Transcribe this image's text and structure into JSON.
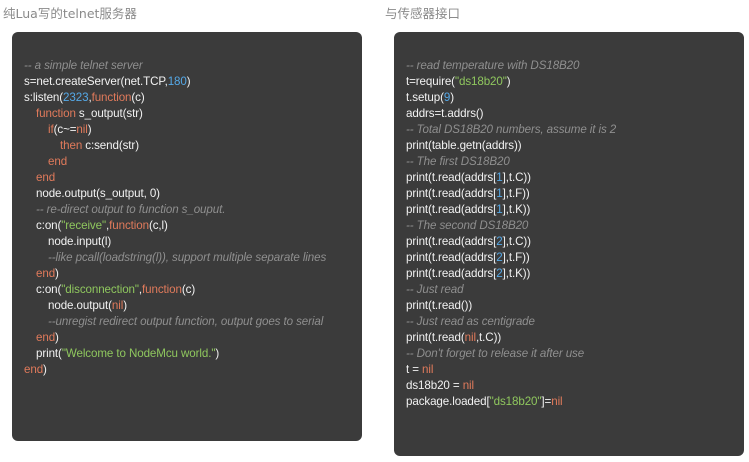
{
  "left": {
    "heading": "纯Lua写的telnet服务器",
    "lines": [
      {
        "indent": 0,
        "segs": [
          {
            "t": "cm",
            "v": "-- a simple telnet server"
          }
        ]
      },
      {
        "indent": 0,
        "segs": [
          {
            "t": "tx",
            "v": "s=net.createServer(net.TCP,"
          },
          {
            "t": "nu",
            "v": "180"
          },
          {
            "t": "tx",
            "v": ")"
          }
        ]
      },
      {
        "indent": 0,
        "segs": [
          {
            "t": "tx",
            "v": "s:listen("
          },
          {
            "t": "nu",
            "v": "2323"
          },
          {
            "t": "tx",
            "v": ","
          },
          {
            "t": "kw",
            "v": "function"
          },
          {
            "t": "tx",
            "v": "(c)"
          }
        ]
      },
      {
        "indent": 1,
        "segs": [
          {
            "t": "kw",
            "v": "function"
          },
          {
            "t": "tx",
            "v": " s_output(str)"
          }
        ]
      },
      {
        "indent": 2,
        "segs": [
          {
            "t": "kw",
            "v": "if"
          },
          {
            "t": "tx",
            "v": "(c~="
          },
          {
            "t": "kw",
            "v": "nil"
          },
          {
            "t": "tx",
            "v": ")"
          }
        ]
      },
      {
        "indent": 3,
        "segs": [
          {
            "t": "kw",
            "v": "then"
          },
          {
            "t": "tx",
            "v": " c:send(str)"
          }
        ]
      },
      {
        "indent": 2,
        "segs": [
          {
            "t": "kw",
            "v": "end"
          }
        ]
      },
      {
        "indent": 1,
        "segs": [
          {
            "t": "kw",
            "v": "end"
          }
        ]
      },
      {
        "indent": 1,
        "segs": [
          {
            "t": "tx",
            "v": "node.output(s_output, 0)"
          }
        ]
      },
      {
        "indent": 1,
        "segs": [
          {
            "t": "cm",
            "v": "-- re-direct output to function s_ouput."
          }
        ]
      },
      {
        "indent": 1,
        "segs": [
          {
            "t": "tx",
            "v": "c:on("
          },
          {
            "t": "st",
            "v": "\"receive\""
          },
          {
            "t": "tx",
            "v": ","
          },
          {
            "t": "kw",
            "v": "function"
          },
          {
            "t": "tx",
            "v": "(c,l)"
          }
        ]
      },
      {
        "indent": 2,
        "segs": [
          {
            "t": "tx",
            "v": "node.input(l)"
          }
        ]
      },
      {
        "indent": 2,
        "segs": [
          {
            "t": "cm",
            "v": "--like pcall(loadstring(l)), support multiple separate lines"
          }
        ]
      },
      {
        "indent": 1,
        "segs": [
          {
            "t": "kw",
            "v": "end"
          },
          {
            "t": "tx",
            "v": ")"
          }
        ]
      },
      {
        "indent": 1,
        "segs": [
          {
            "t": "tx",
            "v": "c:on("
          },
          {
            "t": "st",
            "v": "\"disconnection\""
          },
          {
            "t": "tx",
            "v": ","
          },
          {
            "t": "kw",
            "v": "function"
          },
          {
            "t": "tx",
            "v": "(c)"
          }
        ]
      },
      {
        "indent": 2,
        "segs": [
          {
            "t": "tx",
            "v": "node.output("
          },
          {
            "t": "kw",
            "v": "nil"
          },
          {
            "t": "tx",
            "v": ")"
          }
        ]
      },
      {
        "indent": 2,
        "segs": [
          {
            "t": "cm",
            "v": "--unregist redirect output function, output goes to serial"
          }
        ]
      },
      {
        "indent": 1,
        "segs": [
          {
            "t": "kw",
            "v": "end"
          },
          {
            "t": "tx",
            "v": ")"
          }
        ]
      },
      {
        "indent": 1,
        "segs": [
          {
            "t": "tx",
            "v": "print("
          },
          {
            "t": "st",
            "v": "\"Welcome to NodeMcu world.\""
          },
          {
            "t": "tx",
            "v": ")"
          }
        ]
      },
      {
        "indent": 0,
        "segs": [
          {
            "t": "kw",
            "v": "end"
          },
          {
            "t": "tx",
            "v": ")"
          }
        ]
      }
    ]
  },
  "right": {
    "heading": "与传感器接口",
    "lines": [
      {
        "indent": 0,
        "segs": [
          {
            "t": "cm",
            "v": "-- read temperature with DS18B20"
          }
        ]
      },
      {
        "indent": 0,
        "segs": [
          {
            "t": "tx",
            "v": "t=require("
          },
          {
            "t": "st",
            "v": "\"ds18b20\""
          },
          {
            "t": "tx",
            "v": ")"
          }
        ]
      },
      {
        "indent": 0,
        "segs": [
          {
            "t": "tx",
            "v": "t.setup("
          },
          {
            "t": "nu",
            "v": "9"
          },
          {
            "t": "tx",
            "v": ")"
          }
        ]
      },
      {
        "indent": 0,
        "segs": [
          {
            "t": "tx",
            "v": "addrs=t.addrs()"
          }
        ]
      },
      {
        "indent": 0,
        "segs": [
          {
            "t": "cm",
            "v": "-- Total DS18B20 numbers, assume it is 2"
          }
        ]
      },
      {
        "indent": 0,
        "segs": [
          {
            "t": "tx",
            "v": "print(table.getn(addrs))"
          }
        ]
      },
      {
        "indent": 0,
        "segs": [
          {
            "t": "cm",
            "v": "-- The first DS18B20"
          }
        ]
      },
      {
        "indent": 0,
        "segs": [
          {
            "t": "tx",
            "v": "print(t.read(addrs["
          },
          {
            "t": "nu",
            "v": "1"
          },
          {
            "t": "tx",
            "v": "],t.C))"
          }
        ]
      },
      {
        "indent": 0,
        "segs": [
          {
            "t": "tx",
            "v": "print(t.read(addrs["
          },
          {
            "t": "nu",
            "v": "1"
          },
          {
            "t": "tx",
            "v": "],t.F))"
          }
        ]
      },
      {
        "indent": 0,
        "segs": [
          {
            "t": "tx",
            "v": "print(t.read(addrs["
          },
          {
            "t": "nu",
            "v": "1"
          },
          {
            "t": "tx",
            "v": "],t.K))"
          }
        ]
      },
      {
        "indent": 0,
        "segs": [
          {
            "t": "cm",
            "v": "-- The second DS18B20"
          }
        ]
      },
      {
        "indent": 0,
        "segs": [
          {
            "t": "tx",
            "v": "print(t.read(addrs["
          },
          {
            "t": "nu",
            "v": "2"
          },
          {
            "t": "tx",
            "v": "],t.C))"
          }
        ]
      },
      {
        "indent": 0,
        "segs": [
          {
            "t": "tx",
            "v": "print(t.read(addrs["
          },
          {
            "t": "nu",
            "v": "2"
          },
          {
            "t": "tx",
            "v": "],t.F))"
          }
        ]
      },
      {
        "indent": 0,
        "segs": [
          {
            "t": "tx",
            "v": "print(t.read(addrs["
          },
          {
            "t": "nu",
            "v": "2"
          },
          {
            "t": "tx",
            "v": "],t.K))"
          }
        ]
      },
      {
        "indent": 0,
        "segs": [
          {
            "t": "cm",
            "v": "-- Just read"
          }
        ]
      },
      {
        "indent": 0,
        "segs": [
          {
            "t": "tx",
            "v": "print(t.read())"
          }
        ]
      },
      {
        "indent": 0,
        "segs": [
          {
            "t": "cm",
            "v": "-- Just read as centigrade"
          }
        ]
      },
      {
        "indent": 0,
        "segs": [
          {
            "t": "tx",
            "v": "print(t.read("
          },
          {
            "t": "kw",
            "v": "nil"
          },
          {
            "t": "tx",
            "v": ",t.C))"
          }
        ]
      },
      {
        "indent": 0,
        "segs": [
          {
            "t": "cm",
            "v": "-- Don't forget to release it after use"
          }
        ]
      },
      {
        "indent": 0,
        "segs": [
          {
            "t": "tx",
            "v": "t = "
          },
          {
            "t": "kw",
            "v": "nil"
          }
        ]
      },
      {
        "indent": 0,
        "segs": [
          {
            "t": "tx",
            "v": "ds18b20 = "
          },
          {
            "t": "kw",
            "v": "nil"
          }
        ]
      },
      {
        "indent": 0,
        "segs": [
          {
            "t": "tx",
            "v": "package.loaded["
          },
          {
            "t": "st",
            "v": "\"ds18b20\""
          },
          {
            "t": "tx",
            "v": "]="
          },
          {
            "t": "kw",
            "v": "nil"
          }
        ]
      }
    ]
  }
}
